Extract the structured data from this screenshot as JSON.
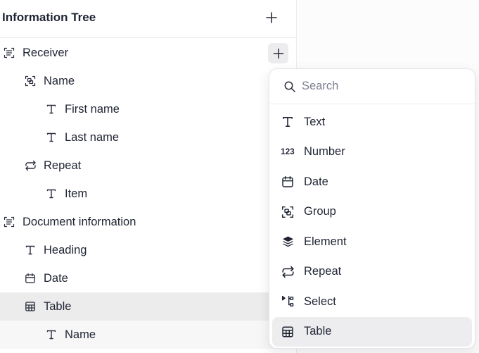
{
  "panel": {
    "title": "Information Tree"
  },
  "tree": [
    {
      "label": "Receiver",
      "icon": "section-icon",
      "level": 0
    },
    {
      "label": "Name",
      "icon": "group-icon",
      "level": 1
    },
    {
      "label": "First name",
      "icon": "text-icon",
      "level": 2
    },
    {
      "label": "Last name",
      "icon": "text-icon",
      "level": 2
    },
    {
      "label": "Repeat",
      "icon": "repeat-icon",
      "level": 1
    },
    {
      "label": "Item",
      "icon": "text-icon",
      "level": 2
    },
    {
      "label": "Document information",
      "icon": "section-icon",
      "level": 0
    },
    {
      "label": "Heading",
      "icon": "text-icon",
      "level": 1
    },
    {
      "label": "Date",
      "icon": "calendar-icon",
      "level": 1
    },
    {
      "label": "Table",
      "icon": "table-icon",
      "level": 1,
      "selected": true
    },
    {
      "label": "Name",
      "icon": "text-icon",
      "level": 2
    }
  ],
  "menu": {
    "search_placeholder": "Search",
    "items": [
      {
        "label": "Text",
        "icon": "text-icon"
      },
      {
        "label": "Number",
        "icon": "number-icon",
        "glyph": "123"
      },
      {
        "label": "Date",
        "icon": "calendar-icon"
      },
      {
        "label": "Group",
        "icon": "group-icon"
      },
      {
        "label": "Element",
        "icon": "layers-icon"
      },
      {
        "label": "Repeat",
        "icon": "repeat-icon"
      },
      {
        "label": "Select",
        "icon": "select-icon"
      },
      {
        "label": "Table",
        "icon": "table-icon",
        "active": true
      }
    ]
  },
  "colors": {
    "text": "#1f2433",
    "muted": "#7d8190",
    "selected_row": "#ececed",
    "border": "#ececee"
  }
}
